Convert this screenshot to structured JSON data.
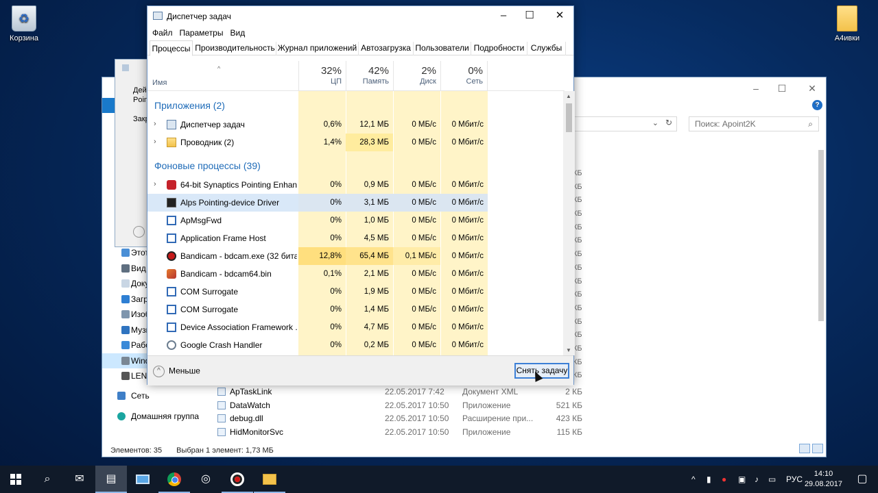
{
  "desktop": {
    "recycle_bin": "Корзина",
    "folder": "А4ивки"
  },
  "explorer": {
    "search_placeholder": "Поиск: Apoint2K",
    "nav": [
      {
        "label": "Этот"
      },
      {
        "label": "Вид"
      },
      {
        "label": "Доку"
      },
      {
        "label": "Загр"
      },
      {
        "label": "Изоб"
      },
      {
        "label": "Музы"
      },
      {
        "label": "Рабо"
      },
      {
        "label": "Wind"
      },
      {
        "label": "LENO"
      },
      {
        "label": "Сеть"
      },
      {
        "label": "Домашняя группа"
      }
    ],
    "files": [
      {
        "name": "ApTaskLink",
        "date": "22.05.2017 7:42",
        "type": "Документ XML",
        "size": "2 КБ"
      },
      {
        "name": "DataWatch",
        "date": "22.05.2017 10:50",
        "type": "Приложение",
        "size": "521 КБ"
      },
      {
        "name": "debug.dll",
        "date": "22.05.2017 10:50",
        "type": "Расширение при...",
        "size": "423 КБ"
      },
      {
        "name": "HidMonitorSvc",
        "date": "22.05.2017 10:50",
        "type": "Приложение",
        "size": "115 КБ"
      }
    ],
    "size_unit": "КБ",
    "status_items": "Элементов: 35",
    "status_selected": "Выбран 1 элемент: 1,73 МБ",
    "dialog_text": [
      "Дей",
      "Poin",
      "Закр"
    ]
  },
  "taskmgr": {
    "title": "Диспетчер задач",
    "menu": [
      "Файл",
      "Параметры",
      "Вид"
    ],
    "tabs": [
      "Процессы",
      "Производительность",
      "Журнал приложений",
      "Автозагрузка",
      "Пользователи",
      "Подробности",
      "Службы"
    ],
    "columns": {
      "name": "Имя",
      "cpu_pct": "32%",
      "cpu": "ЦП",
      "mem_pct": "42%",
      "mem": "Память",
      "disk_pct": "2%",
      "disk": "Диск",
      "net_pct": "0%",
      "net": "Сеть"
    },
    "group_apps": "Приложения (2)",
    "group_bg": "Фоновые процессы (39)",
    "apps": [
      {
        "name": "Диспетчер задач",
        "cpu": "0,6%",
        "mem": "12,1 МБ",
        "disk": "0 МБ/с",
        "net": "0 Мбит/с",
        "icon": "task-manager-icon"
      },
      {
        "name": "Проводник (2)",
        "cpu": "1,4%",
        "mem": "28,3 МБ",
        "disk": "0 МБ/с",
        "net": "0 Мбит/с",
        "icon": "explorer-icon"
      }
    ],
    "background": [
      {
        "name": "64-bit Synaptics Pointing Enhan...",
        "cpu": "0%",
        "mem": "0,9 МБ",
        "disk": "0 МБ/с",
        "net": "0 Мбит/с",
        "icon": "synaptics-icon"
      },
      {
        "name": "Alps Pointing-device Driver",
        "cpu": "0%",
        "mem": "3,1 МБ",
        "disk": "0 МБ/с",
        "net": "0 Мбит/с",
        "icon": "alps-icon"
      },
      {
        "name": "ApMsgFwd",
        "cpu": "0%",
        "mem": "1,0 МБ",
        "disk": "0 МБ/с",
        "net": "0 Мбит/с",
        "icon": "window-app-icon"
      },
      {
        "name": "Application Frame Host",
        "cpu": "0%",
        "mem": "4,5 МБ",
        "disk": "0 МБ/с",
        "net": "0 Мбит/с",
        "icon": "window-app-icon"
      },
      {
        "name": "Bandicam - bdcam.exe (32 бита)",
        "cpu": "12,8%",
        "mem": "65,4 МБ",
        "disk": "0,1 МБ/с",
        "net": "0 Мбит/с",
        "icon": "bandicam-record-icon"
      },
      {
        "name": "Bandicam - bdcam64.bin",
        "cpu": "0,1%",
        "mem": "2,1 МБ",
        "disk": "0 МБ/с",
        "net": "0 Мбит/с",
        "icon": "bandicam-icon"
      },
      {
        "name": "COM Surrogate",
        "cpu": "0%",
        "mem": "1,9 МБ",
        "disk": "0 МБ/с",
        "net": "0 Мбит/с",
        "icon": "window-app-icon"
      },
      {
        "name": "COM Surrogate",
        "cpu": "0%",
        "mem": "1,4 МБ",
        "disk": "0 МБ/с",
        "net": "0 Мбит/с",
        "icon": "window-app-icon"
      },
      {
        "name": "Device Association Framework ...",
        "cpu": "0%",
        "mem": "4,7 МБ",
        "disk": "0 МБ/с",
        "net": "0 Мбит/с",
        "icon": "window-app-icon"
      },
      {
        "name": "Google Crash Handler",
        "cpu": "0%",
        "mem": "0,2 МБ",
        "disk": "0 МБ/с",
        "net": "0 Мбит/с",
        "icon": "google-crash-icon"
      }
    ],
    "fewer_label": "Меньше",
    "end_task_label": "Снять задачу"
  },
  "taskbar": {
    "lang": "РУС",
    "time": "14:10",
    "date": "29.08.2017"
  },
  "colors": {
    "accent": "#1e6bb8",
    "heat_low": "#fff4c8",
    "heat_high": "#ffd966",
    "selection": "#d9e8f8"
  }
}
